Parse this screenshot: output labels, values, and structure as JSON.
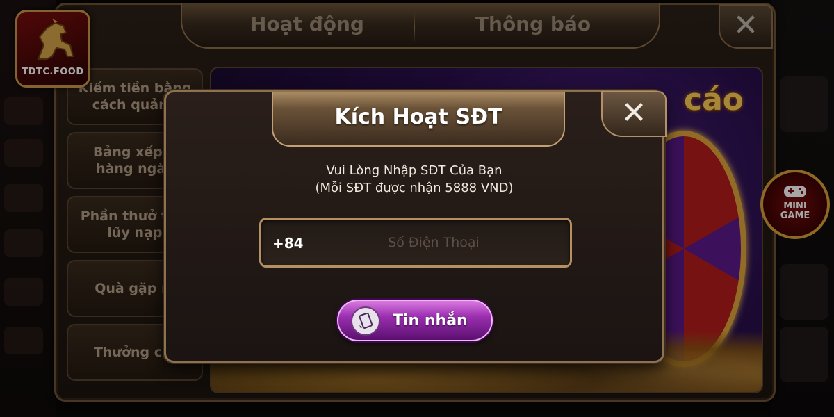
{
  "logo": {
    "text": "TDTC.FOOD"
  },
  "tabs": [
    {
      "label": "Hoạt động"
    },
    {
      "label": "Thông báo"
    }
  ],
  "menu": [
    {
      "label": "Kiếm tiền bằng cách quảng"
    },
    {
      "label": "Bảng xếp h hàng ngày"
    },
    {
      "label": "Phần thưở tích lũy nạp"
    },
    {
      "label": "Quà gặp m"
    },
    {
      "label": "Thưởng chi"
    }
  ],
  "banner": {
    "title_fragment": "cáo"
  },
  "mini_game": {
    "label": "MINI\nGAME"
  },
  "modal": {
    "title": "Kích Hoạt SĐT",
    "message_line1": "Vui Lòng Nhập SĐT Của Bạn",
    "message_line2": "(Mỗi SĐT được nhận 5888 VND)",
    "country_code": "+84",
    "phone_placeholder": "Số Điện Thoại",
    "phone_value": "",
    "sms_button_label": "Tin nhắn"
  },
  "icons": {
    "close": "close-icon",
    "sms": "message-phone-icon",
    "gamepad": "gamepad-icon",
    "logo": "horse-logo-icon"
  },
  "colors": {
    "accent_gold": "#c99a4a",
    "button_purple": "#9b2fb0",
    "panel_dark": "#1d150f"
  }
}
